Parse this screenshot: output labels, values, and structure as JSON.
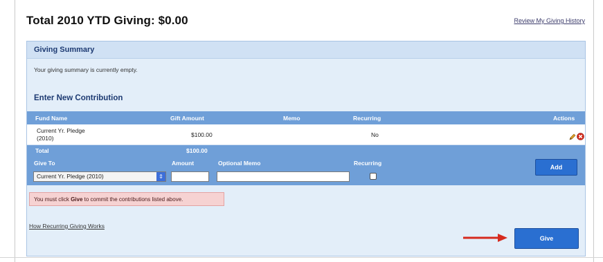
{
  "page": {
    "title": "Total 2010 YTD Giving: $0.00",
    "history_link": "Review My Giving History"
  },
  "summary": {
    "title": "Giving Summary",
    "empty_text": "Your giving summary is currently empty."
  },
  "contribution": {
    "heading": "Enter New Contribution",
    "columns": [
      "Fund Name",
      "Gift Amount",
      "Memo",
      "Recurring",
      "Actions"
    ],
    "rows": [
      {
        "fund_line1": "Current Yr. Pledge",
        "fund_line2": "(2010)",
        "amount": "$100.00",
        "memo": "",
        "recurring": "No"
      }
    ],
    "total_label": "Total",
    "total_value": "$100.00"
  },
  "form": {
    "give_to_label": "Give To",
    "amount_label": "Amount",
    "memo_label": "Optional Memo",
    "recurring_label": "Recurring",
    "fund_selected": "Current Yr. Pledge (2010)",
    "add_button": "Add"
  },
  "warning": {
    "prefix": "You must click ",
    "bold": "Give",
    "suffix": " to commit the contributions listed above."
  },
  "recurring_link": "How Recurring Giving Works",
  "give_button": "Give",
  "icons": {
    "edit": "pencil-icon",
    "remove": "delete-icon",
    "pointer": "arrow-icon"
  },
  "colors": {
    "accent": "#2a6fd1",
    "grid_header": "#6f9fd8",
    "warning_bg": "#f6d2d2",
    "arrow": "#d62a1e"
  }
}
